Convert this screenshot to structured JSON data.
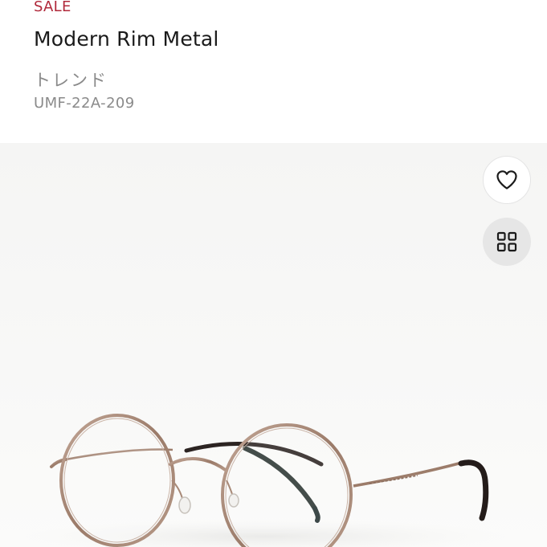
{
  "product": {
    "badge": "SALE",
    "name": "Modern Rim Metal",
    "category": "トレンド",
    "sku": "UMF-22A-209"
  },
  "actions": {
    "favorite_icon": "heart-icon",
    "gallery_icon": "grid-icon"
  },
  "colors": {
    "sale": "#b0283a",
    "title": "#1a1a1a",
    "muted": "#8a8a8a",
    "frame": "#a88a78"
  }
}
